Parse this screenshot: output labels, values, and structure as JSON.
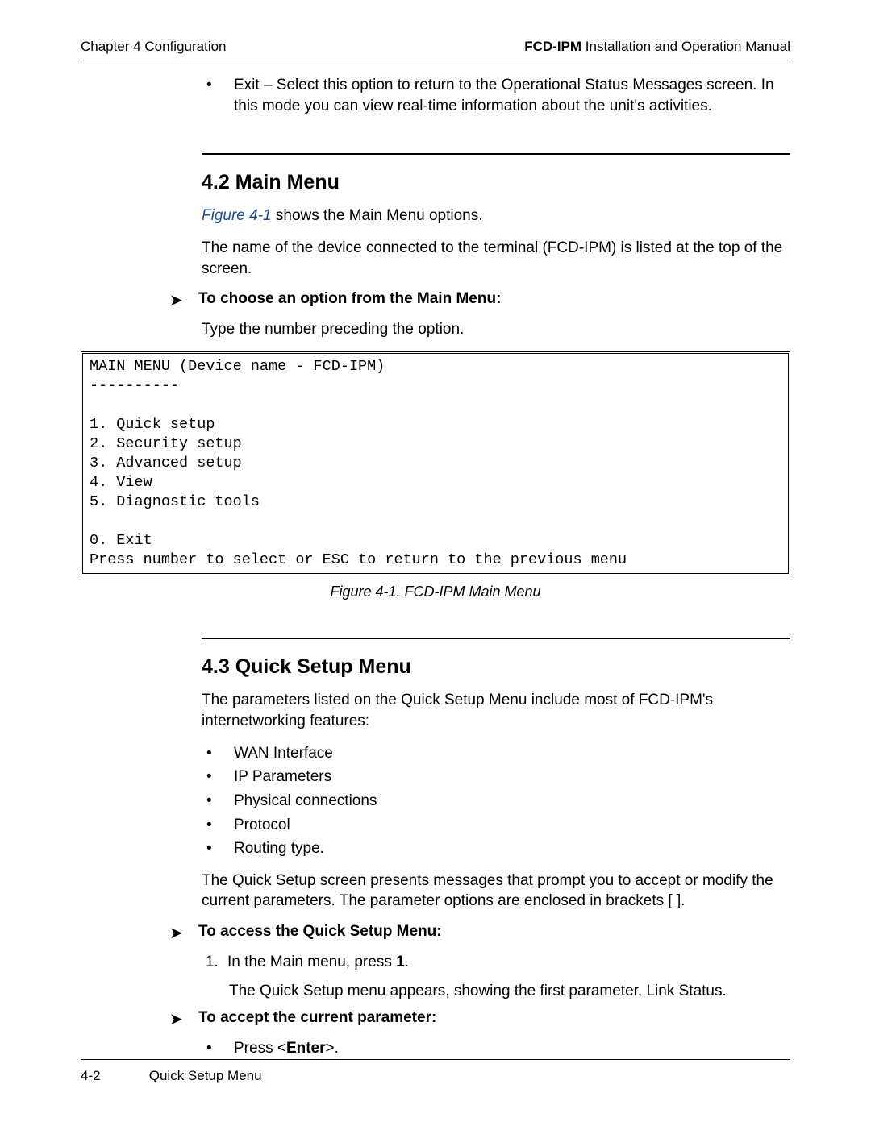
{
  "header": {
    "left": "Chapter 4  Configuration",
    "right_bold": "FCD-IPM",
    "right_rest": " Installation and Operation Manual"
  },
  "top_bullet": "Exit – Select this option to return to the Operational Status Messages screen. In this mode you can view real-time information about the unit's activities.",
  "sec42": {
    "title": "4.2  Main Menu",
    "fig_ref": "Figure 4-1",
    "p1_rest": " shows the Main Menu options.",
    "p2": "The name of the device connected to the terminal (FCD-IPM) is listed at the top of the screen.",
    "proc_title": "To choose an option from the Main Menu:",
    "proc_body": "Type the number preceding the option."
  },
  "terminal": "MAIN MENU (Device name - FCD-IPM)\n----------\n\n1. Quick setup\n2. Security setup\n3. Advanced setup\n4. View\n5. Diagnostic tools\n\n0. Exit\nPress number to select or ESC to return to the previous menu",
  "fig_caption": "Figure 4-1.  FCD-IPM Main Menu",
  "sec43": {
    "title": "4.3  Quick Setup Menu",
    "p1": "The parameters listed on the Quick Setup Menu include most of FCD-IPM's internetworking features:",
    "bullets": [
      "WAN Interface",
      "IP Parameters",
      "Physical connections",
      "Protocol",
      "Routing type."
    ],
    "p2": "The Quick Setup screen presents messages that prompt you to accept or modify the current parameters. The parameter options are enclosed in brackets [ ].",
    "proc1_title": "To access the Quick Setup Menu:",
    "proc1_item_pre": "In the Main menu, press ",
    "proc1_item_bold": "1",
    "proc1_item_post": ".",
    "proc1_sub": "The Quick Setup menu appears, showing the first parameter, Link Status.",
    "proc2_title": "To accept the current parameter:",
    "proc2_item_pre": "Press <",
    "proc2_item_bold": "Enter",
    "proc2_item_post": ">."
  },
  "footer": {
    "page": "4-2",
    "title": "Quick Setup Menu"
  }
}
